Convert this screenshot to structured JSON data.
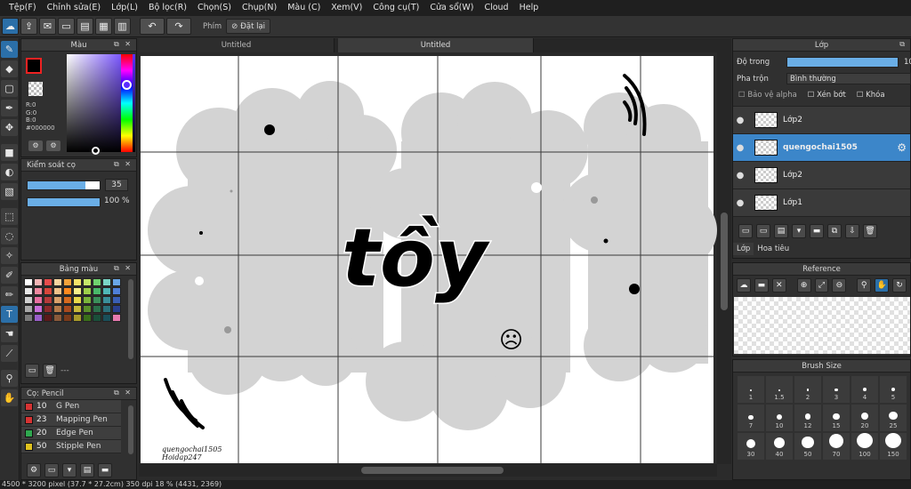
{
  "menu": [
    "Tệp(F)",
    "Chỉnh sửa(E)",
    "Lớp(L)",
    "Bộ lọc(R)",
    "Chọn(S)",
    "Chụp(N)",
    "Màu (C)",
    "Xem(V)",
    "Công cụ(T)",
    "Cửa sổ(W)",
    "Cloud",
    "Help"
  ],
  "toolbar": {
    "stabilizer_label": "Phím",
    "reset_label": "Đặt lại"
  },
  "tabs": [
    "Untitled",
    "Untitled"
  ],
  "color_panel": {
    "title": "Màu",
    "r": "R:0",
    "g": "G:0",
    "b": "B:0",
    "hex": "#000000",
    "fg_color": "#000000"
  },
  "brush_control": {
    "title": "Kiểm soát cọ",
    "size": "35",
    "opacity": "100 %",
    "size_fraction": 0.8,
    "opacity_fraction": 1.0
  },
  "palette": {
    "title": "Bảng màu",
    "footer_text": "---",
    "colors": [
      "#ffffff",
      "#f4b6b6",
      "#e84c4c",
      "#f7d6a0",
      "#f2a33a",
      "#f5e46a",
      "#c7e86a",
      "#6fd36f",
      "#7ad6c7",
      "#6aa7e8",
      "#e8e8e8",
      "#f08aa0",
      "#d8463b",
      "#f0c28a",
      "#ff8a1e",
      "#f7ef8a",
      "#9ed04a",
      "#49b86a",
      "#4fb7b7",
      "#4f7fd8",
      "#cfcfcf",
      "#e86fa0",
      "#b53a3a",
      "#d9a06a",
      "#d66a1e",
      "#e8d84a",
      "#7ab43a",
      "#3a8f5a",
      "#3a8f9a",
      "#3a5fb5",
      "#a8a8a8",
      "#c86fd8",
      "#8a2a2a",
      "#b57a4a",
      "#a84a1e",
      "#c8b83a",
      "#5a8f2a",
      "#2a6f4a",
      "#2a6f7a",
      "#2a3f8f",
      "#7a7a7a",
      "#9a5fc8",
      "#5a1a1a",
      "#8a5a3a",
      "#7a3a1a",
      "#a89a2a",
      "#3a6f1a",
      "#1a4f3a",
      "#1a4f5a",
      "#e87ab0"
    ]
  },
  "brush_list": {
    "title": "Cọ: Pencil",
    "items": [
      {
        "size": "10",
        "name": "G Pen",
        "color": "#d63333"
      },
      {
        "size": "23",
        "name": "Mapping Pen",
        "color": "#d63333"
      },
      {
        "size": "20",
        "name": "Edge Pen",
        "color": "#2fa84f"
      },
      {
        "size": "50",
        "name": "Stipple Pen",
        "color": "#e0c21e"
      }
    ]
  },
  "layers": {
    "title": "Lớp",
    "opacity_label": "Độ trong",
    "opacity_value": "100",
    "blend_label": "Pha trộn",
    "blend_value": "Bình thường",
    "protect_alpha": "Bảo vệ alpha",
    "clipping": "Xén bớt",
    "lock": "Khóa",
    "items": [
      {
        "name": "Lớp2",
        "selected": false
      },
      {
        "name": "quengochai1505",
        "selected": true
      },
      {
        "name": "Lớp2",
        "selected": false
      },
      {
        "name": "Lớp1",
        "selected": false
      }
    ],
    "tab_layer": "Lớp",
    "tab_navigator": "Hoa tiêu"
  },
  "reference": {
    "title": "Reference"
  },
  "brush_size": {
    "title": "Brush Size",
    "sizes": [
      "1",
      "1.5",
      "2",
      "3",
      "4",
      "5",
      "7",
      "10",
      "12",
      "15",
      "20",
      "25",
      "30",
      "40",
      "50",
      "70",
      "100",
      "150"
    ]
  },
  "canvas": {
    "word": "tồy",
    "signature_line1": "quengochai1505",
    "signature_line2": "Hoidap247",
    "frown": "☹"
  },
  "status": "4500 * 3200 pixel  (37.7 * 27.2cm)  350 dpi  18 %  (4431, 2369)"
}
